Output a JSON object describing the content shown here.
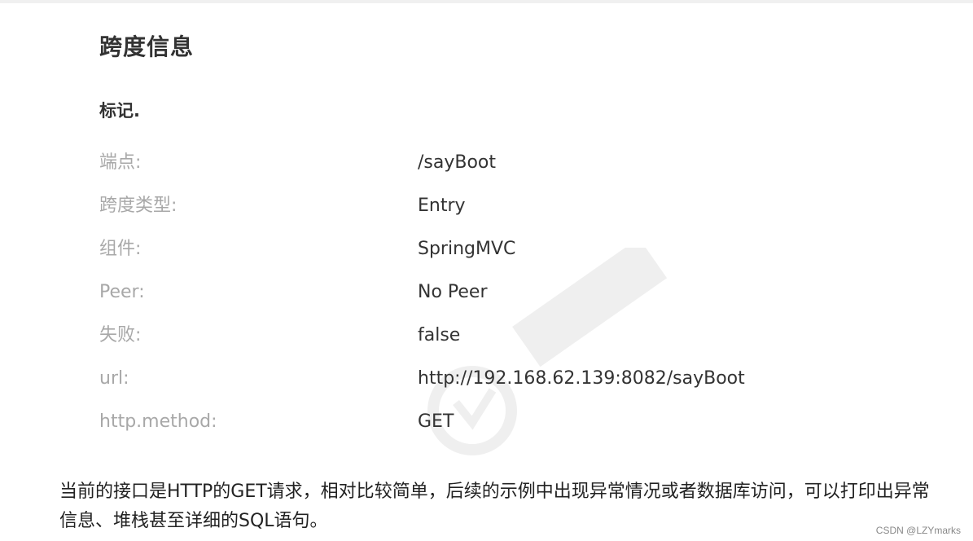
{
  "panel": {
    "title": "跨度信息",
    "section_title": "标记.",
    "rows": [
      {
        "key": "端点:",
        "value": "/sayBoot"
      },
      {
        "key": "跨度类型:",
        "value": "Entry"
      },
      {
        "key": "组件:",
        "value": "SpringMVC"
      },
      {
        "key": "Peer:",
        "value": "No Peer"
      },
      {
        "key": "失败:",
        "value": "false"
      },
      {
        "key": "url:",
        "value": "http://192.168.62.139:8082/sayBoot"
      },
      {
        "key": "http.method:",
        "value": "GET"
      }
    ]
  },
  "description": "当前的接口是HTTP的GET请求，相对比较简单，后续的示例中出现异常情况或者数据库访问，可以打印出异常信息、堆栈甚至详细的SQL语句。",
  "credit": "CSDN @LZYmarks",
  "colors": {
    "key_text": "#a8a8a8",
    "value_text": "#333333",
    "title_text": "#333333"
  }
}
